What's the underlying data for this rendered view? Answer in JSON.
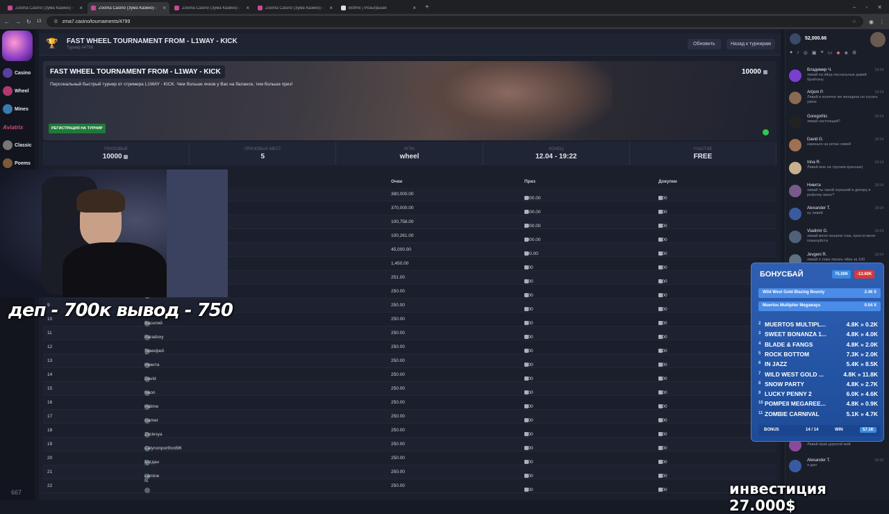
{
  "browser": {
    "tabs": [
      {
        "label": "Zooma Casino (Зума Казино) -",
        "active": false
      },
      {
        "label": "Zooma Casino (Зума Казино) -",
        "active": true
      },
      {
        "label": "Zooma Casino (Зума Казино) -",
        "active": false
      },
      {
        "label": "Zooma Casino (Зума Казино) -",
        "active": false
      },
      {
        "label": "BotRix | Розыгрыши",
        "active": false
      }
    ],
    "url": "zma7.casino/tournaments/4799",
    "tab_count_badge": "13"
  },
  "leftnav": {
    "items": [
      {
        "label": "Casino"
      },
      {
        "label": "Wheel"
      },
      {
        "label": "Mines"
      },
      {
        "label": "Aviatrix"
      },
      {
        "label": "Classic"
      },
      {
        "label": "Poems"
      }
    ],
    "counter": "667"
  },
  "header": {
    "title": "FAST WHEEL TOURNAMENT FROM - L1WAY - KICK",
    "subtitle": "Турнир #4799",
    "refresh_button": "Обновить",
    "back_button": "Назад к турнирам"
  },
  "banner": {
    "title": "FAST WHEEL TOURNAMENT FROM - L1WAY - KICK",
    "description": "Персональный быстрый турнир от стримера L1WAY - KICK. Чем больше очков у Вас на балансе, тем больше приз!",
    "prize_badge": "10000",
    "register_button": "РЕГИСТРАЦИЯ НА ТУРНИР"
  },
  "stats": [
    {
      "label": "Призовые",
      "value": "10000"
    },
    {
      "label": "Призовых мест",
      "value": "5"
    },
    {
      "label": "Игра",
      "value": "wheel"
    },
    {
      "label": "Конец",
      "value": "12.04 - 19:22"
    },
    {
      "label": "Участие",
      "value": "FREE"
    }
  ],
  "table": {
    "headers": {
      "points": "Очки",
      "prize": "Приз",
      "rebuys": "Докупки"
    },
    "rows": [
      {
        "place": "1",
        "player": "",
        "points": "380,000.00",
        "prize": "4000.00",
        "rebuys": "0.00"
      },
      {
        "place": "2",
        "player": "",
        "points": "370,000.00",
        "prize": "2500.00",
        "rebuys": "0.00"
      },
      {
        "place": "3",
        "player": "",
        "points": "100,758.00",
        "prize": "2000.00",
        "rebuys": "0.00"
      },
      {
        "place": "4",
        "player": "",
        "points": "100,261.00",
        "prize": "1000.00",
        "rebuys": "0.00"
      },
      {
        "place": "5",
        "player": "",
        "points": "45,000.00",
        "prize": "500.00",
        "rebuys": "0.00"
      },
      {
        "place": "6",
        "player": "",
        "points": "1,450.00",
        "prize": "0.00",
        "rebuys": "0.00"
      },
      {
        "place": "7",
        "player": "",
        "points": "251.00",
        "prize": "0.00",
        "rebuys": "0.00"
      },
      {
        "place": "8",
        "player": "",
        "points": "250.00",
        "prize": "0.00",
        "rebuys": "0.00"
      },
      {
        "place": "9",
        "player": "Тио Т.",
        "points": "250.00",
        "prize": "0.00",
        "rebuys": "0.00"
      },
      {
        "place": "10",
        "player": "Василий",
        "points": "250.00",
        "prize": "0.00",
        "rebuys": "0.00"
      },
      {
        "place": "11",
        "player": "Paradoxy",
        "points": "250.00",
        "prize": "0.00",
        "rebuys": "0.00"
      },
      {
        "place": "12",
        "player": "Тимофей Л.",
        "points": "250.00",
        "prize": "0.00",
        "rebuys": "0.00"
      },
      {
        "place": "13",
        "player": "Никита",
        "points": "250.00",
        "prize": "0.00",
        "rebuys": "0.00"
      },
      {
        "place": "14",
        "player": "David",
        "points": "250.00",
        "prize": "0.00",
        "rebuys": "0.00"
      },
      {
        "place": "15",
        "player": "Neon",
        "points": "250.00",
        "prize": "0.00",
        "rebuys": "0.00"
      },
      {
        "place": "16",
        "player": "Halime L",
        "points": "250.00",
        "prize": "0.00",
        "rebuys": "0.00"
      },
      {
        "place": "17",
        "player": "Gamer",
        "points": "250.00",
        "prize": "0.00",
        "rebuys": "0.00"
      },
      {
        "place": "18",
        "player": "Zxclesya",
        "points": "250.00",
        "prize": "0.00",
        "rebuys": "0.00"
      },
      {
        "place": "19",
        "player": "Calynonportford96",
        "points": "250.00",
        "prize": "0.00",
        "rebuys": "0.00"
      },
      {
        "place": "20",
        "player": "Богдан М.",
        "points": "250.00",
        "prize": "0.00",
        "rebuys": "0.00"
      },
      {
        "place": "21",
        "player": "Lamine N.",
        "points": "250.00",
        "prize": "0.00",
        "rebuys": "0.00"
      },
      {
        "place": "22",
        "player": "",
        "points": "250.00",
        "prize": "0.00",
        "rebuys": "0.00"
      }
    ]
  },
  "chat": {
    "balance": "52,000.66",
    "messages": [
      {
        "name": "Владимир Ч.",
        "text": "ливай на яйца пасхальные давай бройтину",
        "time": "19:14"
      },
      {
        "name": "Artjom P.",
        "text": "Ливай и конечно же женщина но сосать умею",
        "time": "19:14"
      },
      {
        "name": "Goregothic",
        "text": "ливай настоящий?",
        "time": "19:14"
      },
      {
        "name": "David G.",
        "text": "накиньте на ротан ливей",
        "time": "19:14"
      },
      {
        "name": "Irina R.",
        "text": "Ливай мне на трусики красные)",
        "time": "19:14"
      },
      {
        "name": "Никита",
        "text": "ливай ты такой хороший в деперу и рефочку моно?",
        "time": "19:14"
      },
      {
        "name": "Alexander T.",
        "text": "ну ливей",
        "time": "19:14"
      },
      {
        "name": "Vladimir G.",
        "text": "ливай меня лешили глаз, прости меня пожалуйста",
        "time": "19:14"
      },
      {
        "name": "Jevgeni R.",
        "text": "ливай я тоже лизать яйка за 100",
        "time": "19:14"
      },
      {
        "name": "",
        "text": "Ливай прив дорогой мой",
        "time": ""
      },
      {
        "name": "Alexander T.",
        "text": "я дал",
        "time": "19:15"
      }
    ]
  },
  "overlay": {
    "stream_caption": "деп - 700к вывод - 750",
    "investment": "инвестиция 27.000$",
    "bonusbuy": {
      "title": "БОНУСБАЙ",
      "stat_a": "75.00K",
      "stat_b": "-13.60K",
      "current": [
        {
          "game": "Wild West Gold Blazing Bounty",
          "mult": "2.46 X"
        },
        {
          "game": "Muertos Multiplier Megaways",
          "mult": "0.04 X"
        }
      ],
      "list": [
        {
          "n": "2",
          "game": "MUERTOS MULTIPL...",
          "val": "4.8K » 0.2K"
        },
        {
          "n": "3",
          "game": "SWEET BONANZA 1...",
          "val": "4.8K » 4.0K"
        },
        {
          "n": "4",
          "game": "BLADE & FANGS",
          "val": "4.8K » 2.0K"
        },
        {
          "n": "5",
          "game": "ROCK BOTTOM",
          "val": "7.3K » 2.0K"
        },
        {
          "n": "6",
          "game": "IN JAZZ",
          "val": "5.4K » 8.5K"
        },
        {
          "n": "7",
          "game": "WILD WEST GOLD ...",
          "val": "4.8K » 11.8K"
        },
        {
          "n": "8",
          "game": "SNOW PARTY",
          "val": "4.8K » 2.7K"
        },
        {
          "n": "9",
          "game": "LUCKY PENNY 2",
          "val": "6.0K » 4.6K"
        },
        {
          "n": "10",
          "game": "POMPEII MEGAREE...",
          "val": "4.8K » 0.9K"
        },
        {
          "n": "11",
          "game": "ZOMBIE CARNIVAL",
          "val": "5.1K » 4.7K"
        }
      ],
      "footer": {
        "bonus_label": "BONUS",
        "bonus_value": "14 / 14",
        "win_label": "WIN",
        "win_value": "57.1K"
      }
    }
  },
  "colors": {
    "bg": "#161a25",
    "accent_green": "#1f7a3a",
    "bonus_blue": "#2354a4",
    "negative": "#d83838"
  }
}
